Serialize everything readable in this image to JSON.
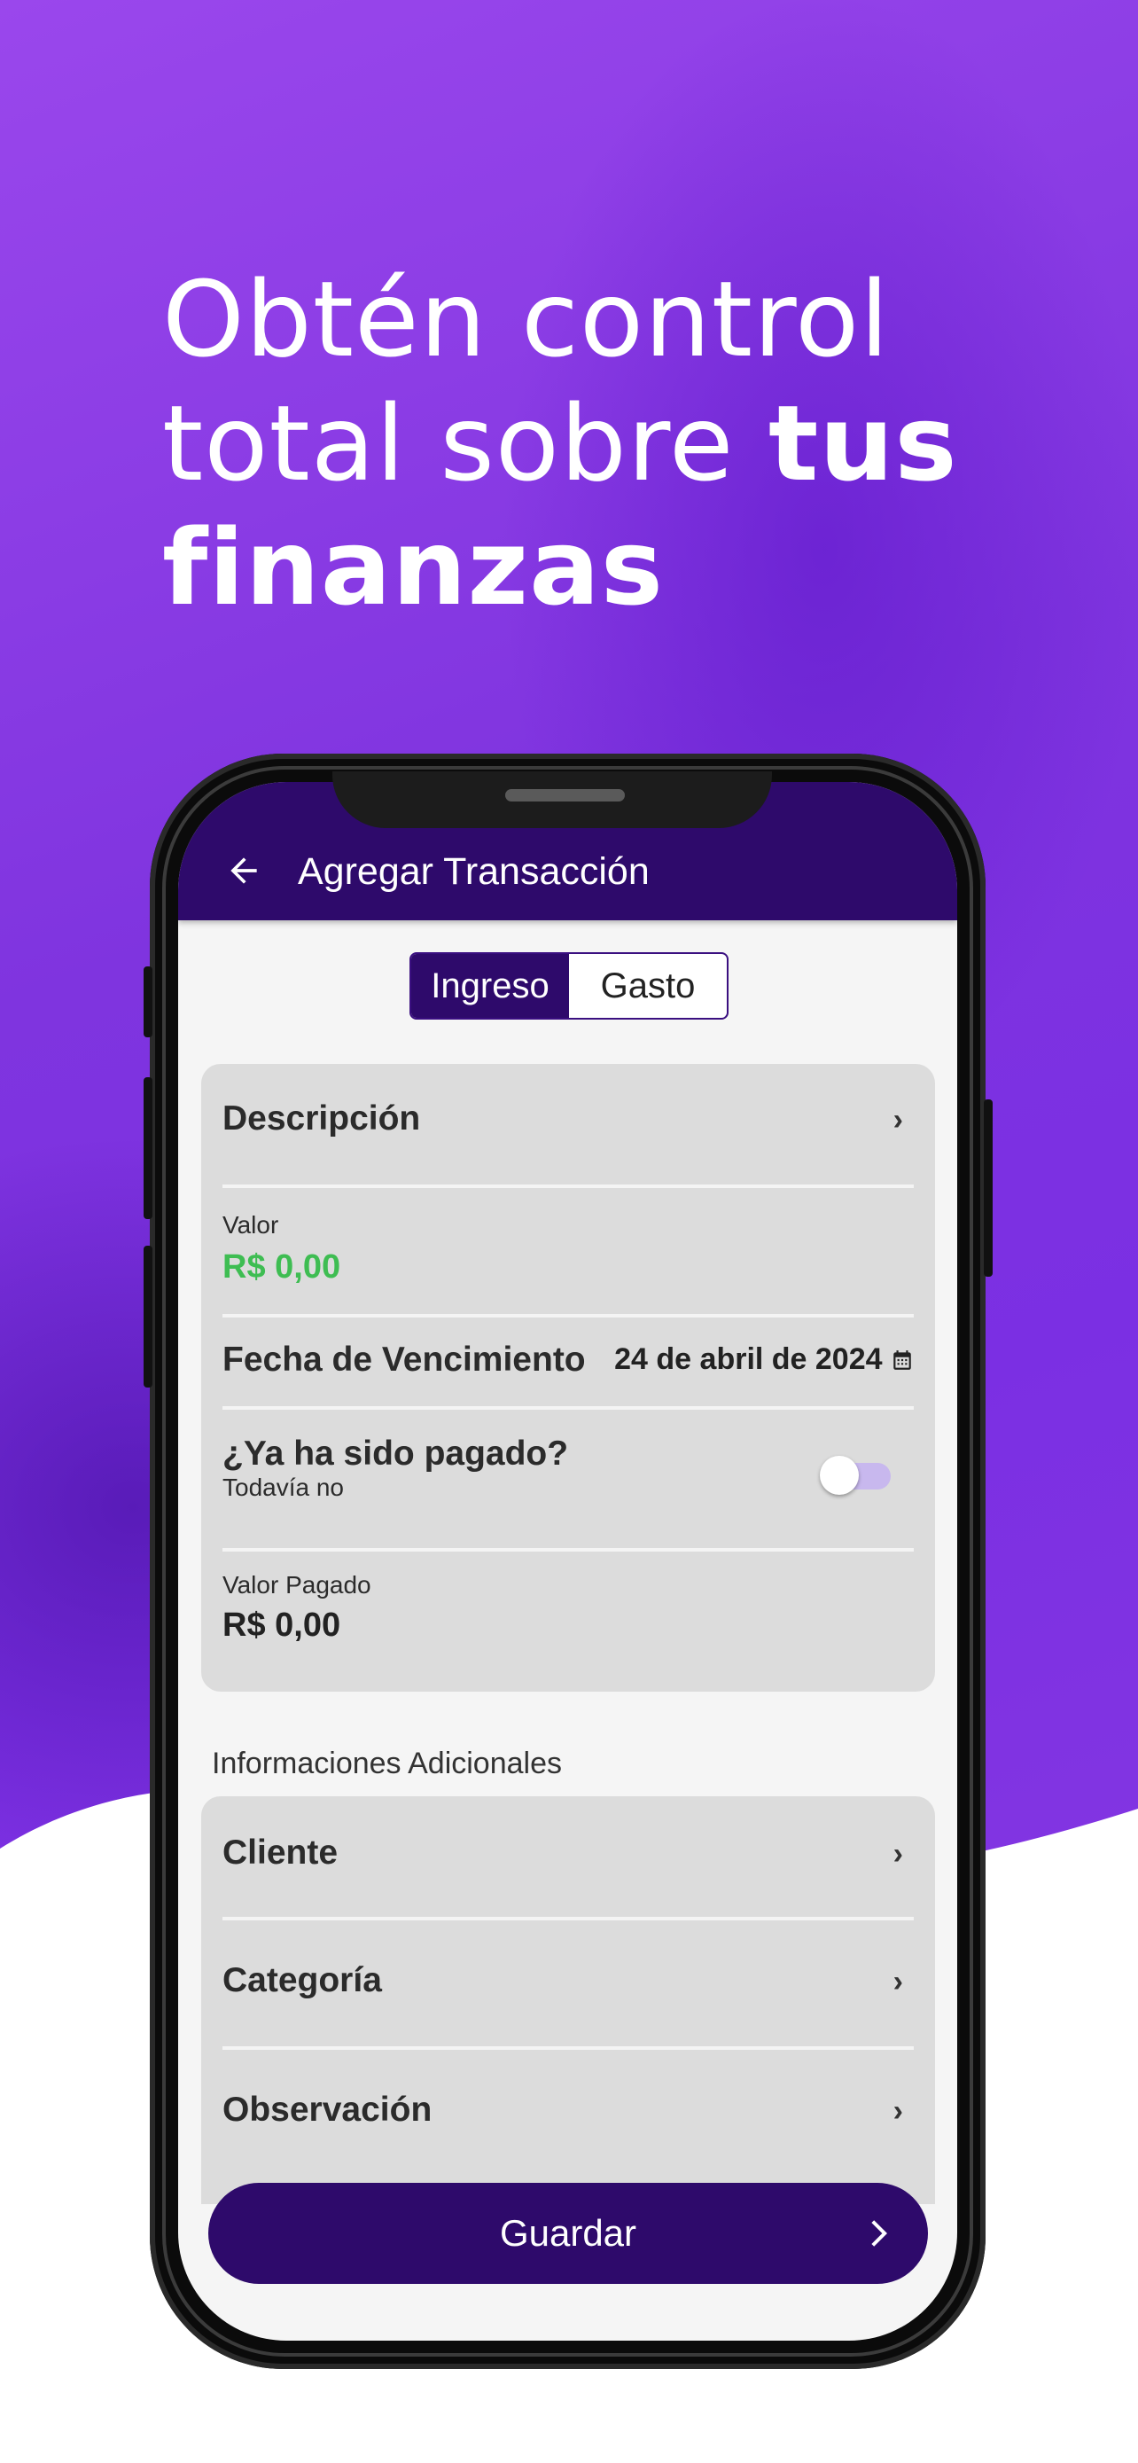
{
  "headline": {
    "line1": "Obtén control",
    "line2_regular": "total sobre ",
    "line2_bold": "tus",
    "line3_bold": "finanzas"
  },
  "appbar": {
    "back_icon": "arrow-left-icon",
    "title": "Agregar Transacción"
  },
  "type_toggle": {
    "options": [
      "Ingreso",
      "Gasto"
    ],
    "selected": "Ingreso"
  },
  "main_card": {
    "description_label": "Descripción",
    "valor_label": "Valor",
    "valor_value": "R$ 0,00",
    "due_date_label": "Fecha de Vencimiento",
    "due_date_value": "24 de abril de 2024",
    "paid_label": "¿Ya ha sido pagado?",
    "paid_status": "Todavía no",
    "paid_toggle_on": false,
    "paid_value_label": "Valor Pagado",
    "paid_value": "R$ 0,00"
  },
  "additional": {
    "title": "Informaciones Adicionales",
    "items": [
      "Cliente",
      "Categoría",
      "Observación"
    ]
  },
  "save_button": {
    "label": "Guardar"
  },
  "colors": {
    "primary": "#2e0a6b",
    "background_purple": "#7e2fe0",
    "value_green": "#3ebd52",
    "card_gray": "#dcdcdc"
  }
}
